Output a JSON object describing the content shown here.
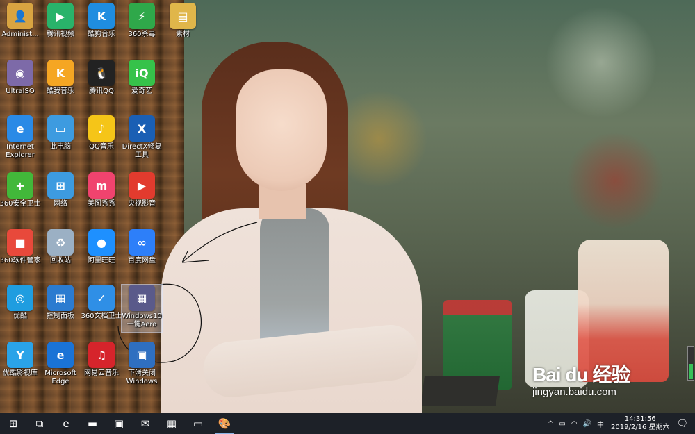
{
  "desktop": {
    "icons": [
      {
        "label": "Administ...",
        "icon": "user-folder-icon",
        "color": "#d9a441"
      },
      {
        "label": "腾讯视频",
        "icon": "tencent-video-icon",
        "color": "#29b36a"
      },
      {
        "label": "酷狗音乐",
        "icon": "kugou-music-icon",
        "color": "#1f8de0"
      },
      {
        "label": "360杀毒",
        "icon": "360-antivirus-icon",
        "color": "#2fa84a"
      },
      {
        "label": "素材",
        "icon": "folder-icon",
        "color": "#e0b64a"
      },
      {
        "label": "UltraISO",
        "icon": "ultraiso-icon",
        "color": "#7d6aa8"
      },
      {
        "label": "酷我音乐",
        "icon": "kuwo-music-icon",
        "color": "#f5a623"
      },
      {
        "label": "腾讯QQ",
        "icon": "qq-icon",
        "color": "#222222"
      },
      {
        "label": "爱奇艺",
        "icon": "iqiyi-icon",
        "color": "#36c24a"
      },
      {
        "label": "Internet\nExplorer",
        "icon": "internet-explorer-icon",
        "color": "#2a8ae6"
      },
      {
        "label": "此电脑",
        "icon": "computer-icon",
        "color": "#3d9be0"
      },
      {
        "label": "QQ音乐",
        "icon": "qq-music-icon",
        "color": "#f5c518"
      },
      {
        "label": "DirectX修复\n工具",
        "icon": "directx-repair-icon",
        "color": "#1a5fb4"
      },
      {
        "label": "360安全卫士",
        "icon": "360-security-icon",
        "color": "#42b83a"
      },
      {
        "label": "网络",
        "icon": "network-icon",
        "color": "#3d9be0"
      },
      {
        "label": "美图秀秀",
        "icon": "meitu-icon",
        "color": "#f0436e"
      },
      {
        "label": "央视影音",
        "icon": "cctv-player-icon",
        "color": "#e23b2e"
      },
      {
        "label": "360软件管家",
        "icon": "360-software-manager-icon",
        "color": "#e8493b"
      },
      {
        "label": "回收站",
        "icon": "recycle-bin-icon",
        "color": "#9bb0c4"
      },
      {
        "label": "阿里旺旺",
        "icon": "aliwangwang-icon",
        "color": "#1e90ff"
      },
      {
        "label": "百度网盘",
        "icon": "baidu-netdisk-icon",
        "color": "#2d7ff9"
      },
      {
        "label": "优酷",
        "icon": "youku-icon",
        "color": "#1f9de0"
      },
      {
        "label": "控制面板",
        "icon": "control-panel-icon",
        "color": "#2b7bd0"
      },
      {
        "label": "360文档卫士",
        "icon": "360-doc-guard-icon",
        "color": "#2f8fe6"
      },
      {
        "label": "Windows10\n一键Aero",
        "icon": "aero-tool-icon",
        "color": "#5a5a8a"
      },
      {
        "label": "优酷影视库",
        "icon": "youku-library-icon",
        "color": "#2aa3e8"
      },
      {
        "label": "Microsoft\nEdge",
        "icon": "edge-icon",
        "color": "#1a73d6"
      },
      {
        "label": "网易云音乐",
        "icon": "netease-music-icon",
        "color": "#d6242b"
      },
      {
        "label": "下滑关闭\nWindows",
        "icon": "slide-shutdown-icon",
        "color": "#2f6fc0"
      }
    ],
    "icon_glyphs": {
      "user-folder-icon": "👤",
      "tencent-video-icon": "▶",
      "kugou-music-icon": "K",
      "360-antivirus-icon": "⚡",
      "folder-icon": "▤",
      "ultraiso-icon": "◉",
      "kuwo-music-icon": "K",
      "qq-icon": "🐧",
      "iqiyi-icon": "iQ",
      "internet-explorer-icon": "e",
      "computer-icon": "▭",
      "qq-music-icon": "♪",
      "directx-repair-icon": "X",
      "360-security-icon": "+",
      "network-icon": "⊞",
      "meitu-icon": "m",
      "cctv-player-icon": "▶",
      "360-software-manager-icon": "■",
      "recycle-bin-icon": "♻",
      "aliwangwang-icon": "●",
      "baidu-netdisk-icon": "∞",
      "youku-icon": "◎",
      "control-panel-icon": "▦",
      "360-doc-guard-icon": "✓",
      "aero-tool-icon": "▦",
      "youku-library-icon": "Y",
      "edge-icon": "e",
      "netease-music-icon": "♫",
      "slide-shutdown-icon": "▣"
    }
  },
  "watermark": {
    "brand": "Bai du 经验",
    "url": "jingyan.baidu.com"
  },
  "taskbar": {
    "buttons": [
      {
        "name": "start-button",
        "glyph": "⊞"
      },
      {
        "name": "task-view-button",
        "glyph": "⧉"
      },
      {
        "name": "taskbar-edge",
        "glyph": "e"
      },
      {
        "name": "taskbar-file-explorer",
        "glyph": "▬"
      },
      {
        "name": "taskbar-store",
        "glyph": "▣"
      },
      {
        "name": "taskbar-mail",
        "glyph": "✉"
      },
      {
        "name": "taskbar-aero-tool",
        "glyph": "▦"
      },
      {
        "name": "taskbar-slide-shutdown",
        "glyph": "▭"
      },
      {
        "name": "taskbar-paint",
        "glyph": "🎨"
      }
    ],
    "tray": {
      "chevron": "^",
      "ime": "中",
      "time": "14:31:56",
      "date": "2019/2/16 星期六"
    }
  }
}
